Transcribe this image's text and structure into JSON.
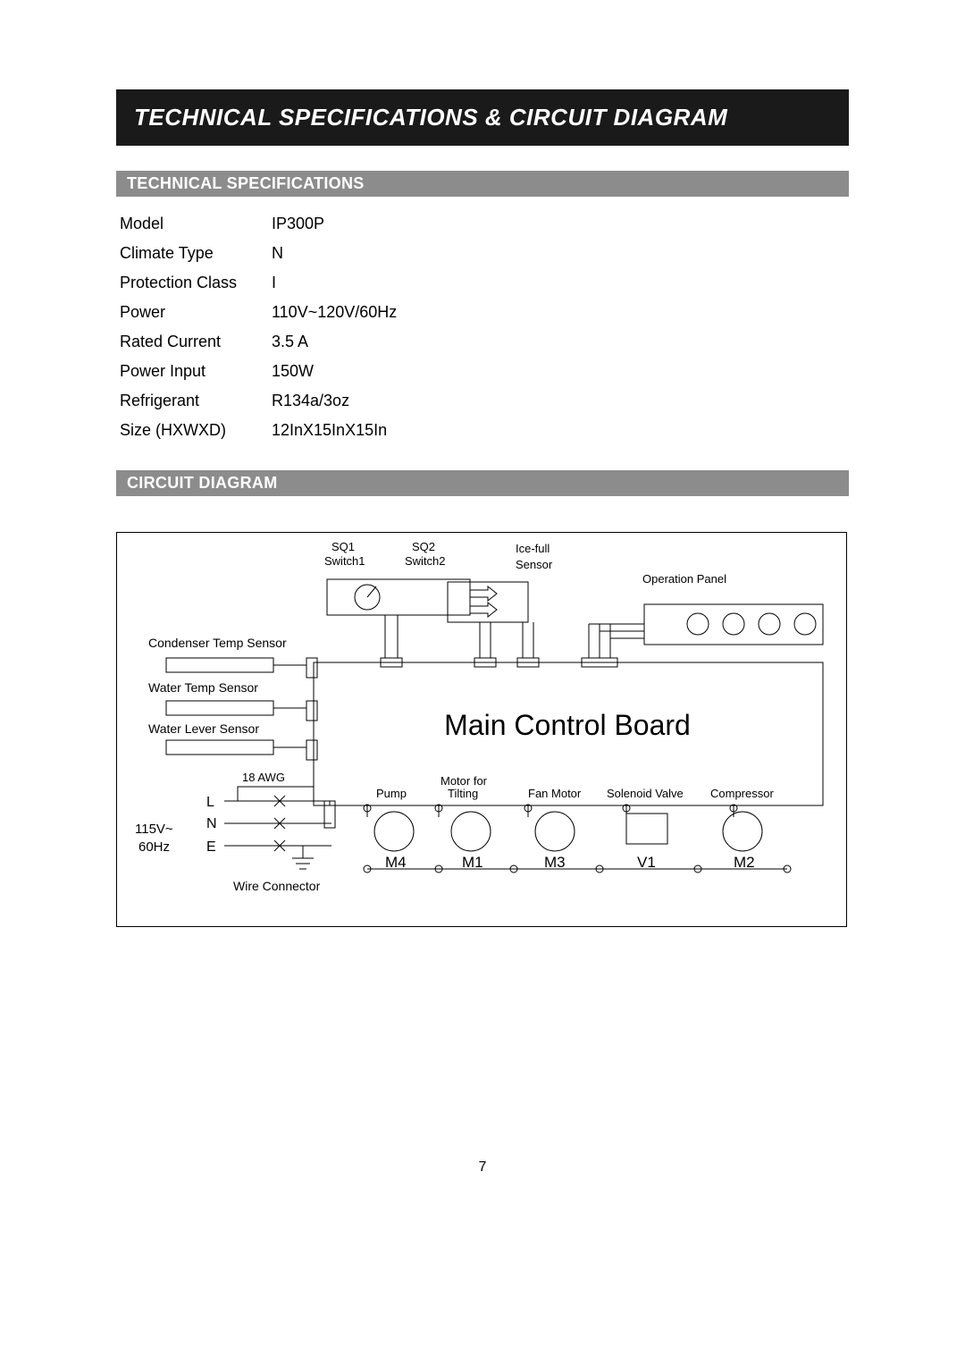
{
  "title": "TECHNICAL SPECIFICATIONS & CIRCUIT DIAGRAM",
  "sections": {
    "specs_heading": "TECHNICAL SPECIFICATIONS",
    "diagram_heading": "CIRCUIT DIAGRAM"
  },
  "specs": [
    {
      "label": "Model",
      "value": "IP300P"
    },
    {
      "label": "Climate Type",
      "value": "N"
    },
    {
      "label": "Protection Class",
      "value": "I"
    },
    {
      "label": "Power",
      "value": "110V~120V/60Hz"
    },
    {
      "label": "Rated Current",
      "value": "3.5 A"
    },
    {
      "label": "Power Input",
      "value": "150W"
    },
    {
      "label": "Refrigerant",
      "value": "R134a/3oz"
    },
    {
      "label": "Size (HXWXD)",
      "value": "12InX15InX15In"
    }
  ],
  "diagram": {
    "main_label": "Main Control Board",
    "sq1": "SQ1",
    "sq1_sub": "Switch1",
    "sq2": "SQ2",
    "sq2_sub": "Switch2",
    "icefull": "Ice-full",
    "icefull_sub": "Sensor",
    "op_panel": "Operation Panel",
    "cond_temp": "Condenser Temp Sensor",
    "water_temp": "Water Temp Sensor",
    "water_level": "Water Lever Sensor",
    "awg": "18 AWG",
    "L": "L",
    "N": "N",
    "E": "E",
    "power_spec": "115V~",
    "power_freq": "60Hz",
    "wire_conn": "Wire Connector",
    "pump": "Pump",
    "motor_tilt1": "Motor for",
    "motor_tilt2": "Tilting",
    "fan_motor": "Fan Motor",
    "solenoid": "Solenoid Valve",
    "compressor": "Compressor",
    "M4": "M4",
    "M1": "M1",
    "M3": "M3",
    "V1": "V1",
    "M2": "M2"
  },
  "page_number": "7"
}
